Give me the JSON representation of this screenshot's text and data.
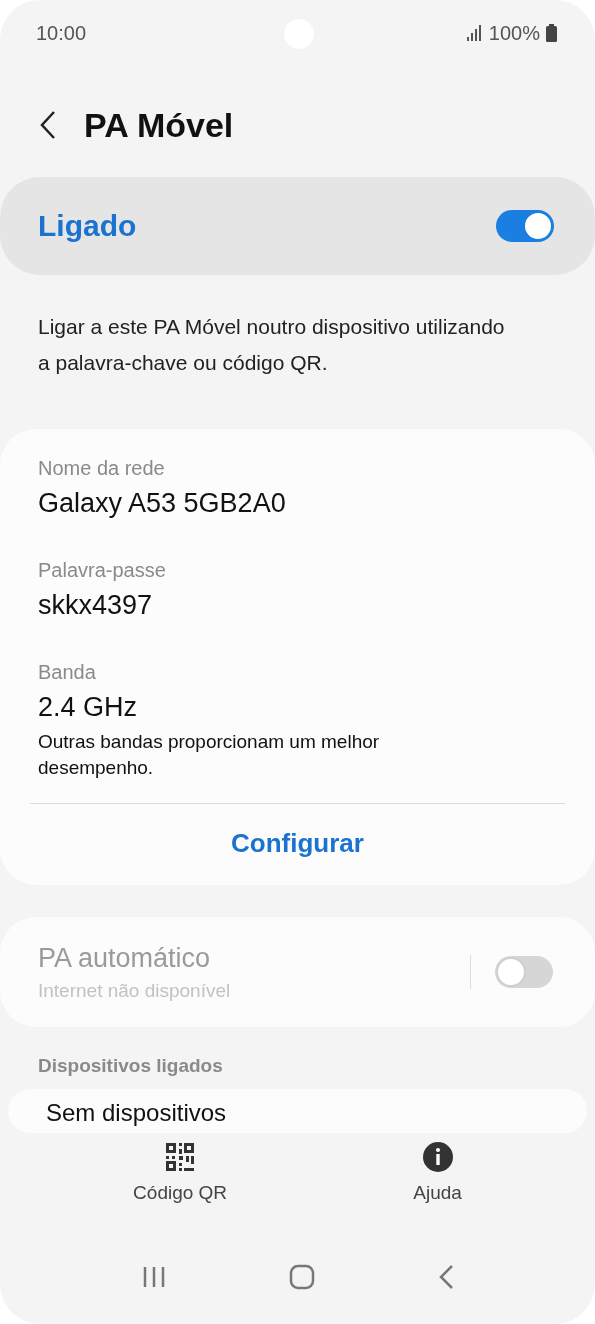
{
  "status_bar": {
    "time": "10:00",
    "battery": "100%"
  },
  "header": {
    "title": "PA Móvel"
  },
  "main_switch": {
    "label": "Ligado",
    "on": true
  },
  "description": "Ligar a este PA Móvel noutro dispositivo utilizando a palavra-chave ou código QR.",
  "fields": [
    {
      "label": "Nome da rede",
      "value": "Galaxy A53 5GB2A0"
    },
    {
      "label": "Palavra-passe",
      "value": "skkx4397"
    },
    {
      "label": "Banda",
      "value": "2.4 GHz",
      "note": "Outras bandas proporcionam um melhor desempenho."
    }
  ],
  "configure_button": "Configurar",
  "auto_hotspot": {
    "title": "PA automático",
    "subtitle": "Internet não disponível",
    "on": false,
    "disabled": true
  },
  "devices_section": {
    "header": "Dispositivos ligados",
    "empty": "Sem dispositivos"
  },
  "bottom_actions": [
    {
      "kind": "qr",
      "label": "Código QR"
    },
    {
      "kind": "info",
      "label": "Ajuda"
    }
  ]
}
